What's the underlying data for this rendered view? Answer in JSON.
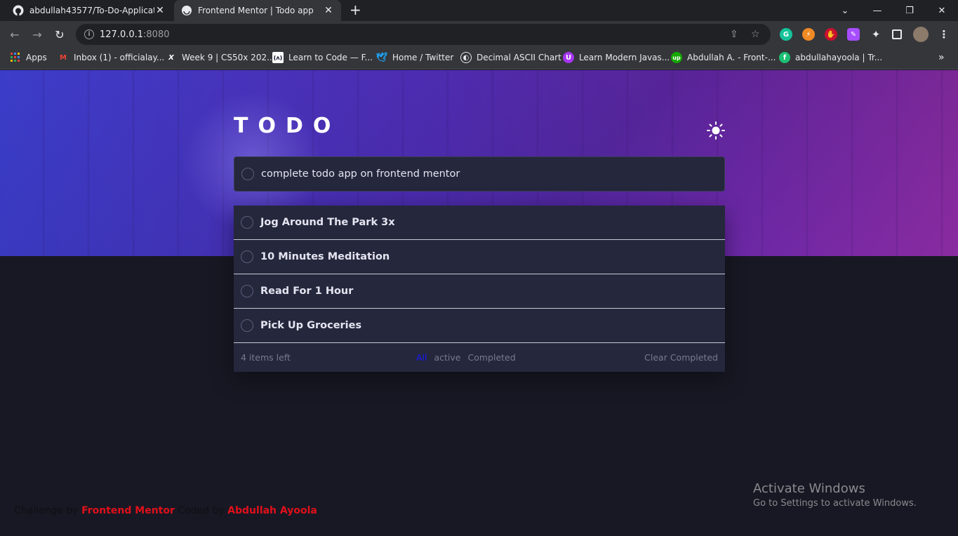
{
  "browser": {
    "tabs": [
      {
        "title": "abdullah43577/To-Do-Applicatio",
        "icon": "github-icon"
      },
      {
        "title": "Frontend Mentor | Todo app",
        "icon": "frontend-mentor-icon"
      }
    ],
    "url_host": "127.0.0.1",
    "url_port": ":8080",
    "bookmarks": [
      {
        "label": "Apps",
        "icon": "apps-grid-icon"
      },
      {
        "label": "Inbox (1) - officialay...",
        "icon": "gmail-icon"
      },
      {
        "label": "Week 9 | CS50x 202...",
        "icon": "cs50-icon"
      },
      {
        "label": "Learn to Code — F...",
        "icon": "freecodecamp-icon"
      },
      {
        "label": "Home / Twitter",
        "icon": "twitter-icon"
      },
      {
        "label": "Decimal ASCII Chart",
        "icon": "globe-icon"
      },
      {
        "label": "Learn Modern Javas...",
        "icon": "udemy-icon"
      },
      {
        "label": "Abdullah A. - Front-...",
        "icon": "upwork-icon"
      },
      {
        "label": "abdullahayoola | Tr...",
        "icon": "fiverr-icon"
      }
    ]
  },
  "app": {
    "title": "TODO",
    "new_todo_text": "complete todo app on frontend mentor",
    "todos": [
      {
        "text": "Jog Around The Park 3x"
      },
      {
        "text": "10 Minutes Meditation"
      },
      {
        "text": "Read For 1 Hour"
      },
      {
        "text": "Pick Up Groceries"
      }
    ],
    "footer": {
      "items_left": "4 items left",
      "filter_all": "All",
      "filter_active": "active",
      "filter_completed": "Completed",
      "clear_completed": "Clear Completed"
    },
    "attribution": {
      "prefix": "Challenge by",
      "link1": "Frontend Mentor",
      "middle": "Coded by",
      "link2": "Abdullah Ayoola"
    }
  },
  "os_watermark": {
    "line1": "Activate Windows",
    "line2": "Go to Settings to activate Windows."
  },
  "colors": {
    "accent_filter": "#1818ff",
    "link_red": "#e0101a",
    "card_bg": "#25273c",
    "page_bg": "#181824"
  }
}
